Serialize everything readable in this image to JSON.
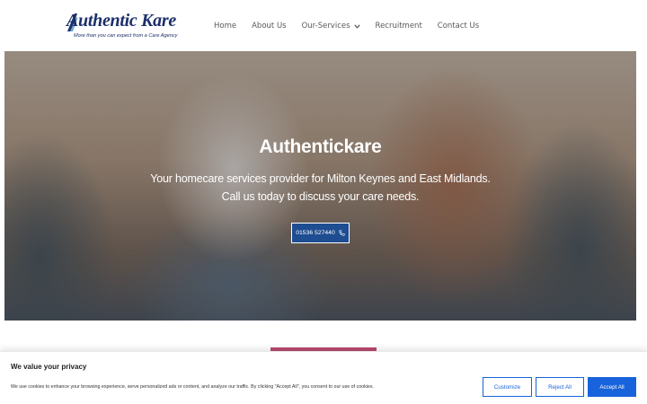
{
  "header": {
    "logo_text": "Authentic Kare",
    "logo_tagline": "More than you can expect from a Care Agency",
    "nav": [
      {
        "label": "Home"
      },
      {
        "label": "About Us"
      },
      {
        "label": "Our-Services",
        "icon": "chevron-down-icon"
      },
      {
        "label": "Recruitment"
      },
      {
        "label": "Contact Us"
      }
    ]
  },
  "hero": {
    "title": "Authentickare",
    "subtitle_line1": "Your homecare services provider for Milton Keynes and East Midlands.",
    "subtitle_line2": "Call us today to discuss your care needs.",
    "phone_button": "01536 527440",
    "phone_icon": "phone-icon"
  },
  "cookie": {
    "title": "We value your privacy",
    "text": "We use cookies to enhance your browsing experience, serve personalized ads or content, and analyze our traffic. By clicking \"Accept All\", you consent to our use of cookies.",
    "customize": "Customize",
    "reject": "Reject All",
    "accept": "Accept All"
  },
  "colors": {
    "brand_navy": "#1c2f6b",
    "accent_blue": "#1863dc",
    "hero_button": "#1e4d92",
    "pink_accent": "#b84a6d"
  }
}
